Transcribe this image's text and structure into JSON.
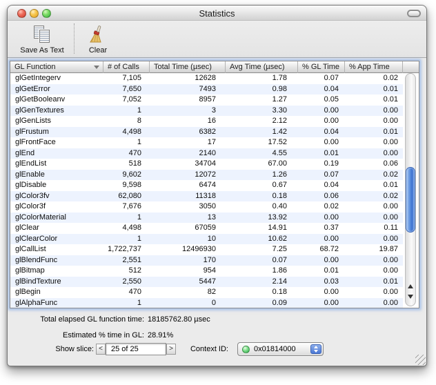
{
  "window": {
    "title": "Statistics"
  },
  "toolbar": {
    "save_label": "Save As Text",
    "clear_label": "Clear"
  },
  "table": {
    "columns": [
      "GL Function",
      "# of Calls",
      "Total Time (µsec)",
      "Avg Time (µsec)",
      "% GL Time",
      "% App Time"
    ],
    "sort_column": "GL Function",
    "sort_direction": "descending",
    "rows": [
      [
        "glGetIntegerv",
        "7,105",
        "12628",
        "1.78",
        "0.07",
        "0.02"
      ],
      [
        "glGetError",
        "7,650",
        "7493",
        "0.98",
        "0.04",
        "0.01"
      ],
      [
        "glGetBooleanv",
        "7,052",
        "8957",
        "1.27",
        "0.05",
        "0.01"
      ],
      [
        "glGenTextures",
        "1",
        "3",
        "3.30",
        "0.00",
        "0.00"
      ],
      [
        "glGenLists",
        "8",
        "16",
        "2.12",
        "0.00",
        "0.00"
      ],
      [
        "glFrustum",
        "4,498",
        "6382",
        "1.42",
        "0.04",
        "0.01"
      ],
      [
        "glFrontFace",
        "1",
        "17",
        "17.52",
        "0.00",
        "0.00"
      ],
      [
        "glEnd",
        "470",
        "2140",
        "4.55",
        "0.01",
        "0.00"
      ],
      [
        "glEndList",
        "518",
        "34704",
        "67.00",
        "0.19",
        "0.06"
      ],
      [
        "glEnable",
        "9,602",
        "12072",
        "1.26",
        "0.07",
        "0.02"
      ],
      [
        "glDisable",
        "9,598",
        "6474",
        "0.67",
        "0.04",
        "0.01"
      ],
      [
        "glColor3fv",
        "62,080",
        "11318",
        "0.18",
        "0.06",
        "0.02"
      ],
      [
        "glColor3f",
        "7,676",
        "3050",
        "0.40",
        "0.02",
        "0.00"
      ],
      [
        "glColorMaterial",
        "1",
        "13",
        "13.92",
        "0.00",
        "0.00"
      ],
      [
        "glClear",
        "4,498",
        "67059",
        "14.91",
        "0.37",
        "0.11"
      ],
      [
        "glClearColor",
        "1",
        "10",
        "10.62",
        "0.00",
        "0.00"
      ],
      [
        "glCallList",
        "1,722,737",
        "12496930",
        "7.25",
        "68.72",
        "19.87"
      ],
      [
        "glBlendFunc",
        "2,551",
        "170",
        "0.07",
        "0.00",
        "0.00"
      ],
      [
        "glBitmap",
        "512",
        "954",
        "1.86",
        "0.01",
        "0.00"
      ],
      [
        "glBindTexture",
        "2,550",
        "5447",
        "2.14",
        "0.03",
        "0.01"
      ],
      [
        "glBegin",
        "470",
        "82",
        "0.18",
        "0.00",
        "0.00"
      ],
      [
        "glAlphaFunc",
        "1",
        "0",
        "0.09",
        "0.00",
        "0.00"
      ]
    ]
  },
  "footer": {
    "total_label": "Total elapsed GL function time:",
    "total_value": "18185762.80 µsec",
    "estimated_label": "Estimated % time in GL:",
    "estimated_value": "28.91%",
    "show_slice_label": "Show slice:",
    "prev_label": "<",
    "next_label": ">",
    "slice_value": "25 of 25",
    "context_label": "Context ID:",
    "context_value": "0x01814000"
  },
  "colors": {
    "row_alt": "#edf3fe",
    "scroll_thumb": "#4a7bd4",
    "focus_ring": "#699be1",
    "context_status": "#2ca548"
  }
}
